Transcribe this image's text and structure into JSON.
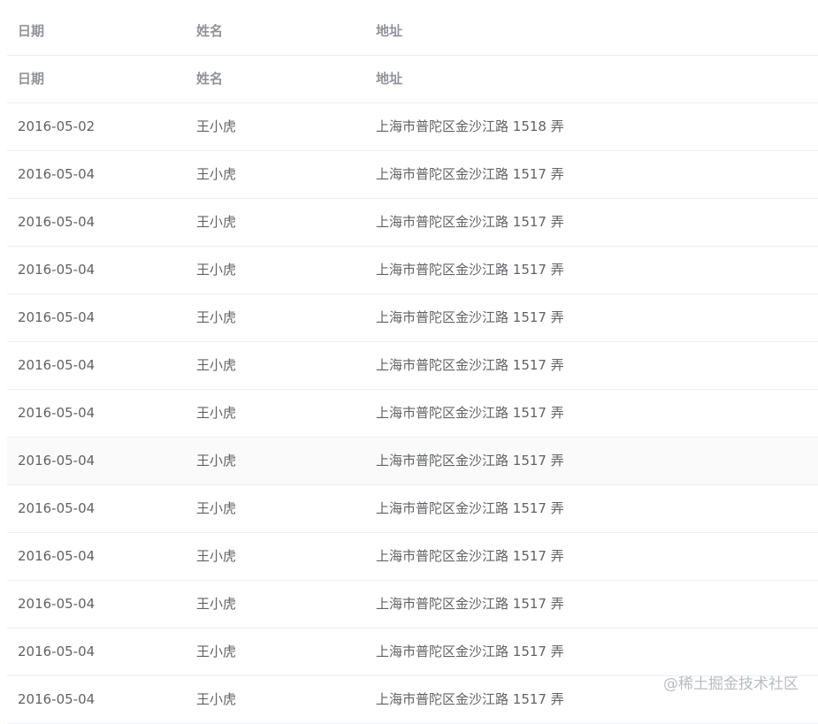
{
  "headers": [
    {
      "date": "日期",
      "name": "姓名",
      "address": "地址"
    },
    {
      "date": "日期",
      "name": "姓名",
      "address": "地址"
    }
  ],
  "rows": [
    {
      "date": "2016-05-02",
      "name": "王小虎",
      "address": "上海市普陀区金沙江路 1518 弄"
    },
    {
      "date": "2016-05-04",
      "name": "王小虎",
      "address": "上海市普陀区金沙江路 1517 弄"
    },
    {
      "date": "2016-05-04",
      "name": "王小虎",
      "address": "上海市普陀区金沙江路 1517 弄"
    },
    {
      "date": "2016-05-04",
      "name": "王小虎",
      "address": "上海市普陀区金沙江路 1517 弄"
    },
    {
      "date": "2016-05-04",
      "name": "王小虎",
      "address": "上海市普陀区金沙江路 1517 弄"
    },
    {
      "date": "2016-05-04",
      "name": "王小虎",
      "address": "上海市普陀区金沙江路 1517 弄"
    },
    {
      "date": "2016-05-04",
      "name": "王小虎",
      "address": "上海市普陀区金沙江路 1517 弄"
    },
    {
      "date": "2016-05-04",
      "name": "王小虎",
      "address": "上海市普陀区金沙江路 1517 弄"
    },
    {
      "date": "2016-05-04",
      "name": "王小虎",
      "address": "上海市普陀区金沙江路 1517 弄"
    },
    {
      "date": "2016-05-04",
      "name": "王小虎",
      "address": "上海市普陀区金沙江路 1517 弄"
    },
    {
      "date": "2016-05-04",
      "name": "王小虎",
      "address": "上海市普陀区金沙江路 1517 弄"
    },
    {
      "date": "2016-05-04",
      "name": "王小虎",
      "address": "上海市普陀区金沙江路 1517 弄"
    },
    {
      "date": "2016-05-04",
      "name": "王小虎",
      "address": "上海市普陀区金沙江路 1517 弄"
    }
  ],
  "watermark": "@稀土掘金技术社区"
}
